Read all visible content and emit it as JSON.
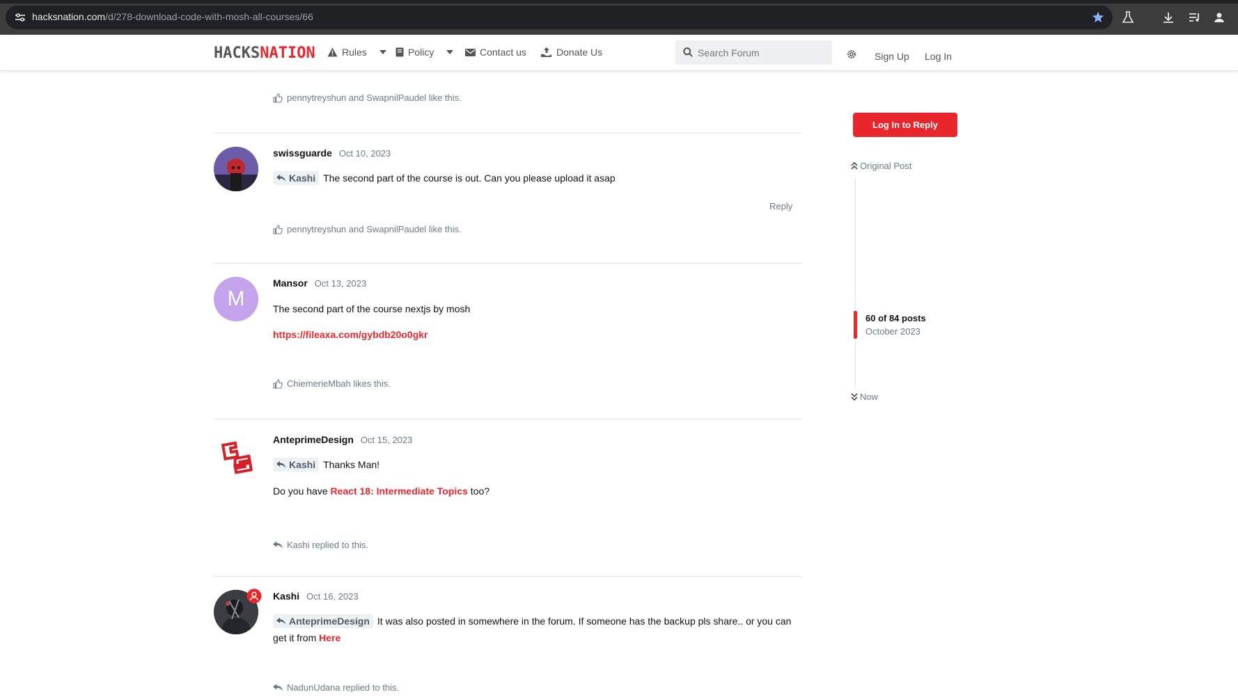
{
  "browser": {
    "url_host": "hacksnation.com",
    "url_path": "/d/278-download-code-with-mosh-all-courses/66"
  },
  "header": {
    "logo_part1": "HACKS",
    "logo_part2": "NATION",
    "nav": {
      "rules": "Rules",
      "policy": "Policy",
      "contact": "Contact us",
      "donate": "Donate Us"
    },
    "search_placeholder": "Search Forum",
    "sign_up": "Sign Up",
    "log_in": "Log In"
  },
  "colors": {
    "accent": "#e8262b",
    "muted": "#6b7a8a"
  },
  "posts": [
    {
      "likes": "pennytreyshun and SwapnilPaudel like this."
    },
    {
      "username": "swissguarde",
      "date": "Oct 10, 2023",
      "mention": "Kashi",
      "text": "The second part of the course is out. Can you please upload it asap",
      "reply": "Reply",
      "likes": "pennytreyshun and SwapnilPaudel like this."
    },
    {
      "username": "Mansor",
      "date": "Oct 13, 2023",
      "avatar_letter": "M",
      "text": "The second part of the course nextjs by mosh",
      "link": "https://fileaxa.com/gybdb20o0gkr",
      "likes": "ChiemerieMbah likes this."
    },
    {
      "username": "AnteprimeDesign",
      "date": "Oct 15, 2023",
      "mention": "Kashi",
      "text": "Thanks Man!",
      "text2_before": "Do you have ",
      "text2_link": "React 18: Intermediate Topics",
      "text2_after": " too?",
      "replied": "Kashi replied to this."
    },
    {
      "username": "Kashi",
      "date": "Oct 16, 2023",
      "mention": "AnteprimeDesign",
      "text": "It was also posted in somewhere in the forum. If someone has the backup pls share.. or you can get it from ",
      "link": "Here",
      "replied": "NadunUdana replied to this."
    }
  ],
  "sidebar": {
    "login_reply": "Log In to Reply",
    "original_post": "Original Post",
    "count": "60 of 84 posts",
    "date": "October 2023",
    "now": "Now"
  }
}
